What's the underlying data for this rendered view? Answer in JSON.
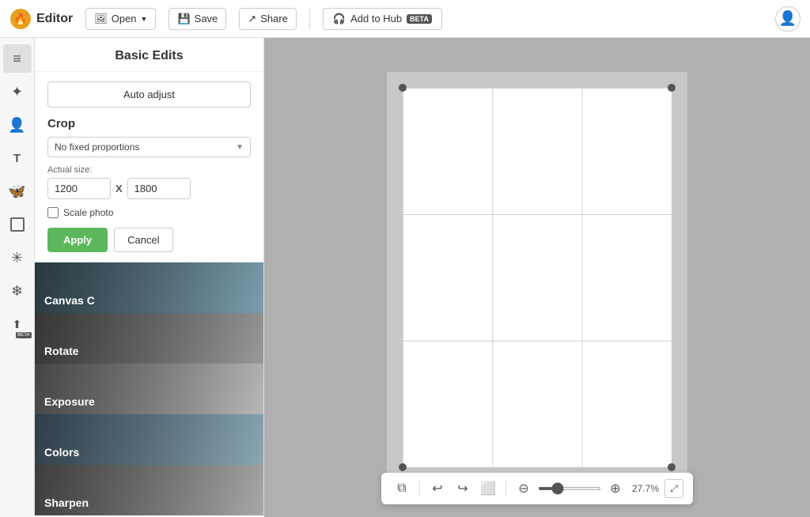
{
  "header": {
    "app_name": "Editor",
    "open_label": "Open",
    "save_label": "Save",
    "share_label": "Share",
    "add_to_hub_label": "Add to Hub",
    "beta_label": "BETA"
  },
  "panel": {
    "title": "Basic Edits",
    "auto_adjust_label": "Auto adjust",
    "crop": {
      "title": "Crop",
      "proportion_label": "No fixed proportions",
      "actual_size_label": "Actual size:",
      "width_value": "1200",
      "height_value": "1800",
      "x_separator": "X",
      "scale_label": "Scale photo",
      "apply_label": "Apply",
      "cancel_label": "Cancel"
    },
    "sections": [
      {
        "label": "Canvas C",
        "tile_color": "#6a8ca0"
      },
      {
        "label": "Rotate",
        "tile_color": "#888888"
      },
      {
        "label": "Exposure",
        "tile_color": "#aaaaaa"
      },
      {
        "label": "Colors",
        "tile_color": "#7a9ab0"
      },
      {
        "label": "Sharpen",
        "tile_color": "#999999"
      }
    ]
  },
  "canvas": {
    "zoom_percent": "27.7%"
  },
  "sidebar": {
    "icons": [
      {
        "name": "sliders-icon",
        "symbol": "⚙",
        "label": "Adjustments",
        "active": true
      },
      {
        "name": "wand-icon",
        "symbol": "✦",
        "label": "Magic"
      },
      {
        "name": "person-icon",
        "symbol": "👤",
        "label": "Portrait"
      },
      {
        "name": "text-icon",
        "symbol": "T",
        "label": "Text"
      },
      {
        "name": "butterfly-icon",
        "symbol": "🦋",
        "label": "Stickers"
      },
      {
        "name": "frame-icon",
        "symbol": "▢",
        "label": "Frames"
      },
      {
        "name": "texture-icon",
        "symbol": "✳",
        "label": "Textures"
      },
      {
        "name": "effects-icon",
        "symbol": "❄",
        "label": "Effects"
      },
      {
        "name": "beta-tools-icon",
        "symbol": "⬆",
        "label": "Beta Tools"
      }
    ]
  }
}
